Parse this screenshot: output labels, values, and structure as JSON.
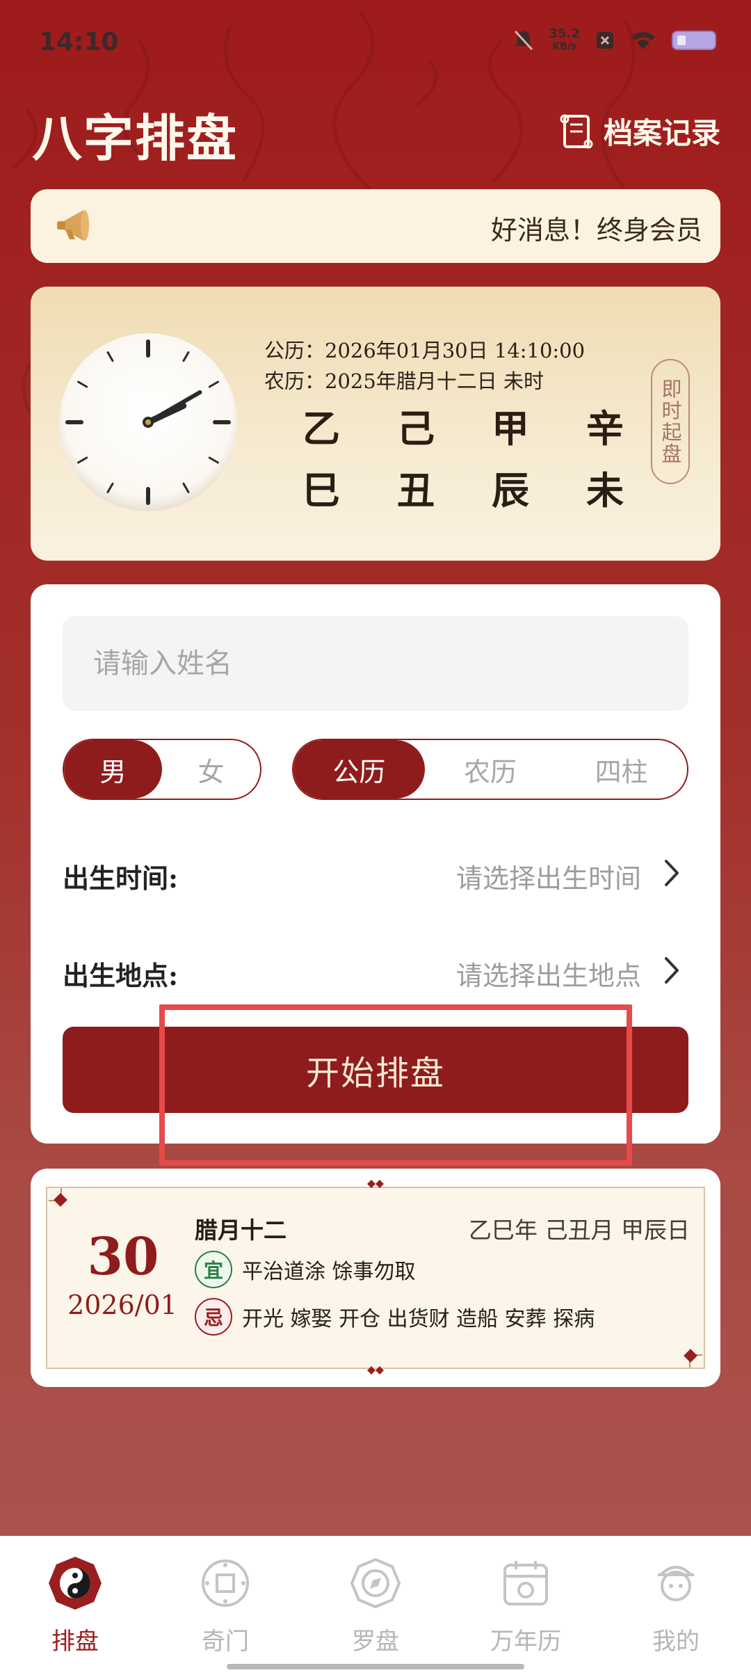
{
  "status_bar": {
    "time": "14:10",
    "net_speed_value": "35.2",
    "net_speed_unit": "KB/s"
  },
  "header": {
    "title": "八字排盘",
    "records_label": "档案记录"
  },
  "notice": {
    "text": "好消息！终身会员"
  },
  "clock_card": {
    "solar": "公历：2026年01月30日 14:10:00",
    "lunar": "农历：2025年腊月十二日 未时",
    "stems": [
      "乙",
      "己",
      "甲",
      "辛"
    ],
    "branches": [
      "巳",
      "丑",
      "辰",
      "未"
    ],
    "instant_label": "即时起盘",
    "clock_hour": 2,
    "clock_minute": 10
  },
  "form": {
    "name_placeholder": "请输入姓名",
    "gender_options": [
      "男",
      "女"
    ],
    "gender_selected": "男",
    "calendar_options": [
      "公历",
      "农历",
      "四柱"
    ],
    "calendar_selected": "公历",
    "birth_time_label": "出生时间:",
    "birth_time_placeholder": "请选择出生时间",
    "birth_place_label": "出生地点:",
    "birth_place_placeholder": "请选择出生地点",
    "start_button": "开始排盘"
  },
  "almanac": {
    "day": "30",
    "year_month": "2026/01",
    "lunar_day": "腊月十二",
    "ganzhi": "乙巳年 己丑月 甲辰日",
    "yi_label": "宜",
    "yi_text": "平治道涂 馀事勿取",
    "ji_label": "忌",
    "ji_text": "开光 嫁娶 开仓 出货财 造船 安葬 探病"
  },
  "tabbar": {
    "tabs": [
      {
        "label": "排盘",
        "icon": "bagua-icon",
        "active": true
      },
      {
        "label": "奇门",
        "icon": "qimen-icon",
        "active": false
      },
      {
        "label": "罗盘",
        "icon": "compass-icon",
        "active": false
      },
      {
        "label": "万年历",
        "icon": "calendar-icon",
        "active": false
      },
      {
        "label": "我的",
        "icon": "profile-icon",
        "active": false
      }
    ]
  },
  "colors": {
    "brand_red": "#8f1c1c",
    "background_red": "#9e1b1b",
    "highlight_box": "#e64a4a"
  }
}
